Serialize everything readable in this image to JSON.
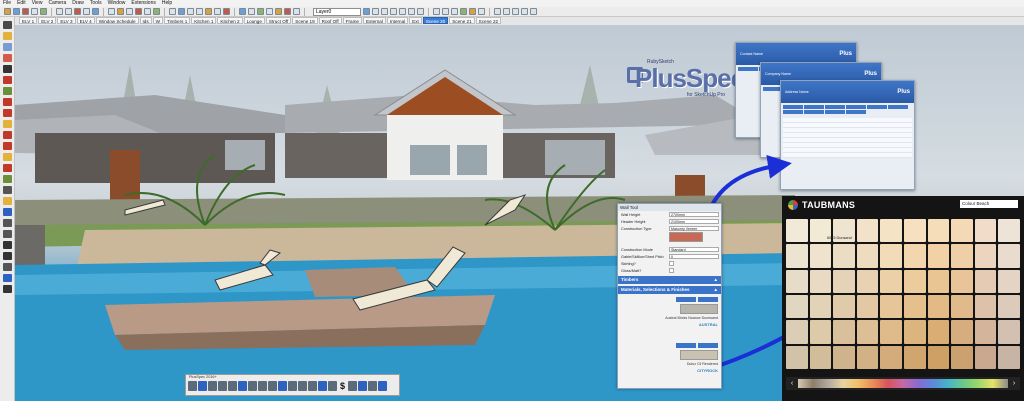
{
  "menu": [
    "File",
    "Edit",
    "View",
    "Camera",
    "Draw",
    "Tools",
    "Window",
    "Extensions",
    "Help"
  ],
  "toolbar": {
    "layer_value": "Layer0"
  },
  "scenes": [
    "ELV 1",
    "ELV 2",
    "ELV 3",
    "ELV 4",
    "Window Schedule",
    "Ids",
    "W",
    "Timbers 1",
    "Kitchen 1",
    "Kitchen 2",
    "Lounge",
    "Struct Off",
    "Scene 19",
    "Roof Off",
    "Frame",
    "External",
    "Internal",
    "Ext",
    "Scene 20",
    "Scene 21",
    "Scene 22"
  ],
  "active_scene": "Scene 20",
  "logo": {
    "top": "RubySketch",
    "name": "PlusSpec",
    "sub": "for SketchUp Pro"
  },
  "report": {
    "field1": "Contact Name",
    "field2": "Company Name",
    "field3": "Address Name",
    "brand": "Plus"
  },
  "paint_panel": {
    "title": "Wall Tool",
    "rows": [
      {
        "label": "Wall Height",
        "value": "2700mm"
      },
      {
        "label": "Header Height",
        "value": "2100mm"
      },
      {
        "label": "Construction Type",
        "value": "Masonry Veneer"
      },
      {
        "label": "Construction Mode",
        "value": "Standard"
      },
      {
        "label": "Gable/Skillion/Shed Pitch",
        "value": "0"
      },
      {
        "label": "Skirting?",
        "value": ""
      },
      {
        "label": "Gloss/Matt?",
        "value": ""
      }
    ],
    "sections": [
      {
        "label": "Timbers",
        "toggle": "▲"
      },
      {
        "label": "Materials, Selections & Finishes",
        "toggle": "▲"
      }
    ],
    "materials": [
      {
        "name": "Austral Bricks Nuance Dunesand",
        "logo": "AUSTRAL"
      },
      {
        "name": "Dulux Cil Rendered",
        "logo": "CITYROCK"
      }
    ]
  },
  "taubmans": {
    "brand": "TAUBMANS",
    "search": "Colour Beach",
    "selected_label": "6015 Dunsand",
    "prev": "‹",
    "next": "›",
    "swatches": [
      "#f1ead8",
      "#f3ead6",
      "#efe4cf",
      "#f2e2c9",
      "#f5e3c6",
      "#f6e0bf",
      "#f6ddb9",
      "#f3d9b6",
      "#f0dcc9",
      "#ede3d6",
      "#ece3d1",
      "#efe3ce",
      "#ebdcc4",
      "#efdbbe",
      "#f2dbb8",
      "#f3d6ae",
      "#f2d1a6",
      "#efcfa6",
      "#ecd4bf",
      "#e9dccf",
      "#e7dcc8",
      "#e9dbc3",
      "#e5d3b7",
      "#e9d2b1",
      "#ecd0a8",
      "#eccb9d",
      "#eac594",
      "#e8c498",
      "#e5cbb4",
      "#e4d4c6",
      "#e1d6c0",
      "#e3d3b6",
      "#dfcbaa",
      "#e3c9a3",
      "#e6c699",
      "#e5c08d",
      "#e3ba85",
      "#e0ba8b",
      "#dec1a9",
      "#dccabb",
      "#dbcdb6",
      "#ddcaa9",
      "#d8c09c",
      "#dcbf96",
      "#dfbb8b",
      "#dcb47d",
      "#d9ad74",
      "#d6ad7e",
      "#d4b59c",
      "#d3c0b0",
      "#d1c2a8",
      "#d2bd9a",
      "#ceb38d",
      "#d2b186",
      "#d4ac7b",
      "#d1a56e",
      "#cea065",
      "#cba170",
      "#caa88f",
      "#c8b4a4"
    ]
  },
  "plusbar": {
    "title": "PlusSpec  2016+"
  }
}
